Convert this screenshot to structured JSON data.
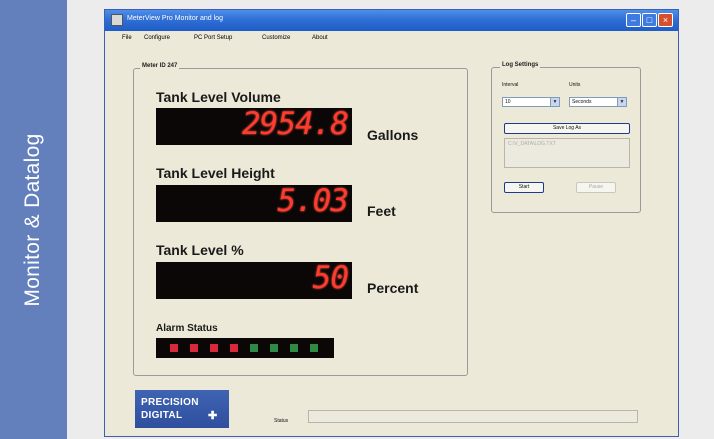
{
  "banner": {
    "text": "Monitor & Datalog",
    "color": "#6380bc"
  },
  "window": {
    "title": "MeterView Pro Monitor and log",
    "menu": [
      "File",
      "Configure",
      "PC Port Setup",
      "Customize",
      "About"
    ]
  },
  "meter": {
    "group_title": "Meter ID 247",
    "readings": [
      {
        "label": "Tank Level Volume",
        "value": "2954.8",
        "unit": "Gallons"
      },
      {
        "label": "Tank Level Height",
        "value": "5.03",
        "unit": "Feet"
      },
      {
        "label": "Tank Level %",
        "value": "50",
        "unit": "Percent"
      }
    ],
    "alarm_label": "Alarm Status",
    "alarm_leds": [
      "red",
      "red",
      "red",
      "red",
      "green",
      "green",
      "green",
      "green"
    ],
    "led_colors": {
      "red": "#d8283a",
      "green": "#2f8a46"
    }
  },
  "log": {
    "group_title": "Log Settings",
    "interval_label": "Interval",
    "interval_value": "10",
    "units_label": "Units",
    "units_value": "Seconds",
    "save_button": "Save Log As",
    "path": "C:\\V_DATA\\LOG.TXT",
    "start_button": "Start",
    "pause_button": "Pause"
  },
  "logo": {
    "line1": "PRECISION",
    "line2": "DIGITAL"
  },
  "status": {
    "label": "Status",
    "value": ""
  }
}
